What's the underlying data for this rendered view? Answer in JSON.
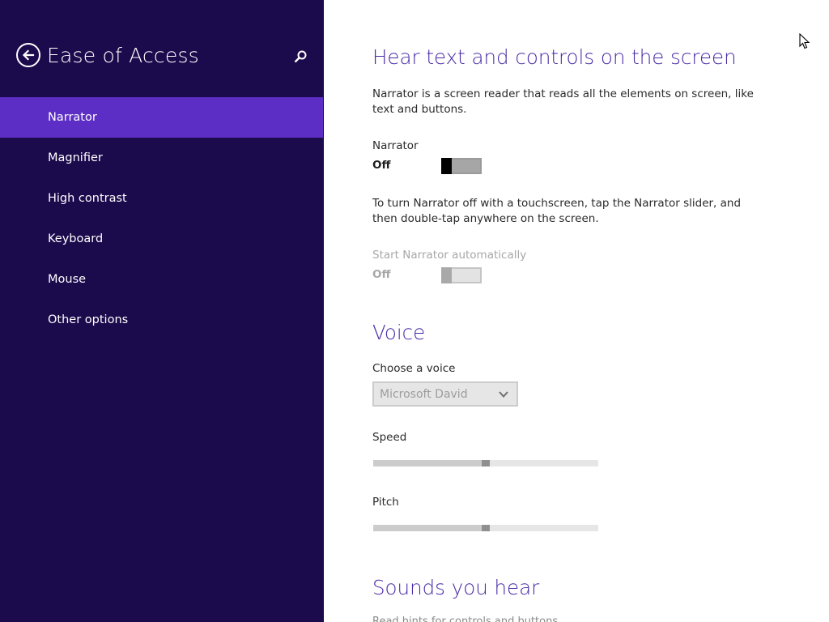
{
  "colors": {
    "sidebar_bg": "#1b0a4c",
    "selected_item_bg": "#5c2ec5",
    "heading": "#4a2aa6",
    "content_bg": "#ffffff"
  },
  "sidebar": {
    "title": "Ease of Access",
    "back_icon": "back-arrow-icon",
    "search_icon": "search-icon",
    "items": [
      {
        "label": "Narrator",
        "selected": true
      },
      {
        "label": "Magnifier",
        "selected": false
      },
      {
        "label": "High contrast",
        "selected": false
      },
      {
        "label": "Keyboard",
        "selected": false
      },
      {
        "label": "Mouse",
        "selected": false
      },
      {
        "label": "Other options",
        "selected": false
      }
    ]
  },
  "main": {
    "hear_section": {
      "heading": "Hear text and controls on the screen",
      "description": "Narrator is a screen reader that reads all the elements on screen, like text and buttons.",
      "narrator_label": "Narrator",
      "narrator_state": "Off",
      "touch_hint": "To turn Narrator off with a touchscreen, tap the Narrator slider, and then double-tap anywhere on the screen.",
      "auto_start_label": "Start Narrator automatically",
      "auto_start_state": "Off"
    },
    "voice_section": {
      "heading": "Voice",
      "choose_voice_label": "Choose a voice",
      "selected_voice": "Microsoft David",
      "speed_label": "Speed",
      "speed_level": 0.5,
      "pitch_label": "Pitch",
      "pitch_level": 0.5
    },
    "sounds_section": {
      "heading": "Sounds you hear",
      "partial_text": "Read hints for controls and buttons"
    }
  }
}
